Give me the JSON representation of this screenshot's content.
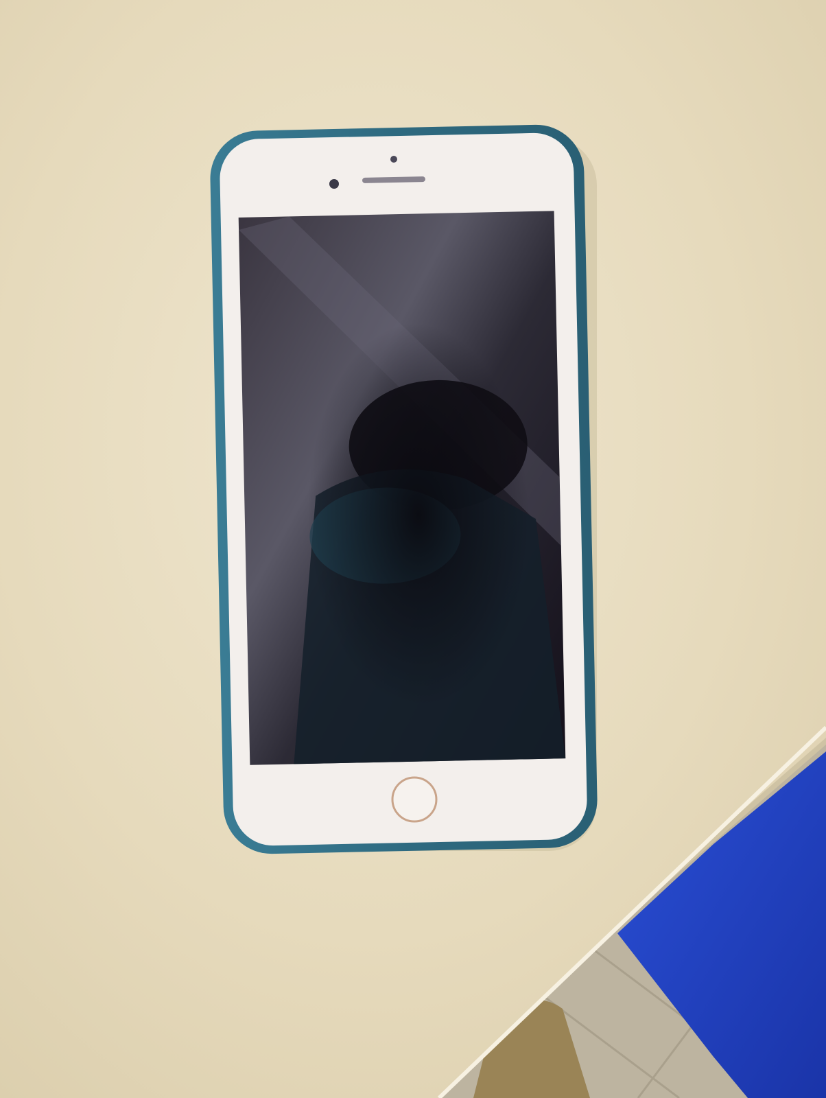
{
  "scene": {
    "table_color": "#e9ddc2",
    "chair_color": "#1f3fbf",
    "phone": {
      "case_color": "#2f6f86",
      "body_color": "#f3efec",
      "screen_color": "#2a2530",
      "home_ring_color": "#c9a48a"
    },
    "icons": [
      "front-camera-icon",
      "earpiece-icon",
      "home-button-icon"
    ]
  }
}
